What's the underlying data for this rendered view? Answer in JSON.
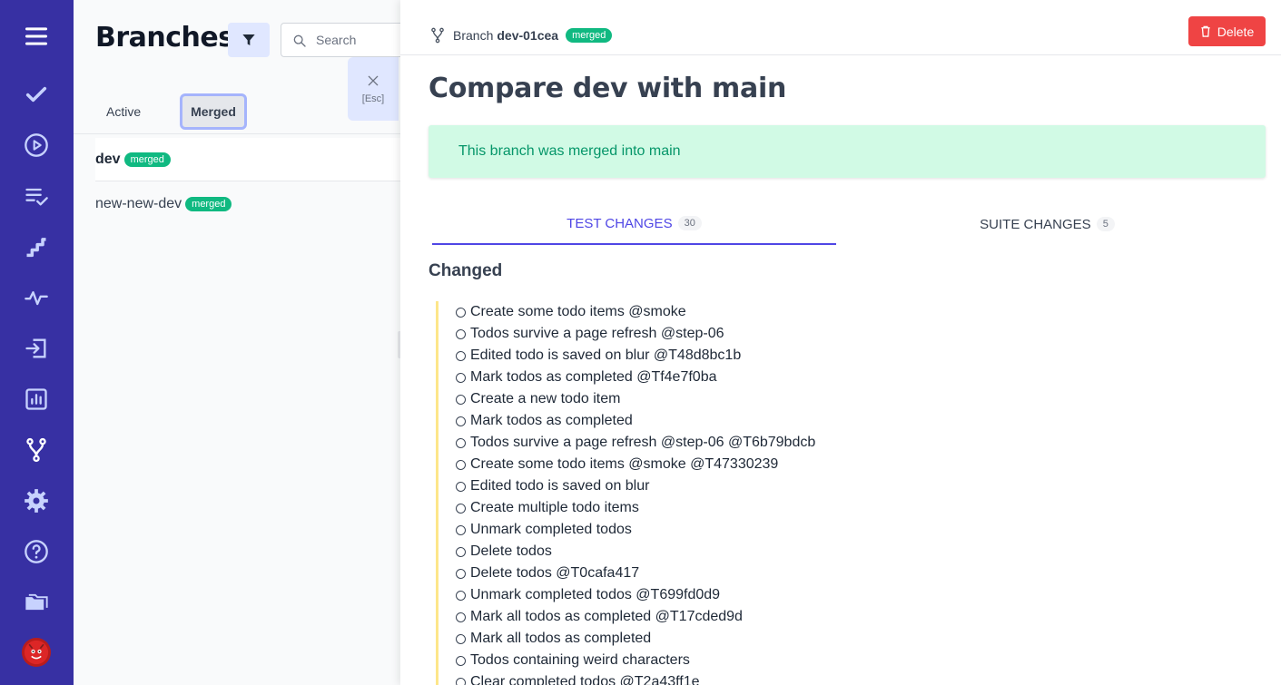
{
  "nav": {
    "items": [
      "check-icon",
      "play-circle-icon",
      "list-check-icon",
      "steps-icon",
      "pulse-icon",
      "import-icon",
      "chart-icon",
      "branch-icon",
      "gear-icon",
      "help-icon",
      "folders-icon"
    ]
  },
  "list": {
    "title": "Branches",
    "search_placeholder": "Search",
    "tab_active": "Active",
    "tab_merged": "Merged",
    "branches": [
      {
        "name": "dev",
        "badge": "merged"
      },
      {
        "name": "new-new-dev",
        "badge": "merged"
      }
    ]
  },
  "close": {
    "esc_label": "[Esc]"
  },
  "detail": {
    "crumb_prefix": "Branch",
    "branch_name": "dev-01cea",
    "branch_badge": "merged",
    "delete_label": "Delete",
    "title": "Compare dev with main",
    "merged_note": "This branch was merged into main",
    "tab_test": "TEST CHANGES",
    "tab_test_count": "30",
    "tab_suite": "SUITE CHANGES",
    "tab_suite_count": "5",
    "changed_heading": "Changed",
    "changes": [
      "Create some todo items @smoke",
      "Todos survive a page refresh @step-06",
      "Edited todo is saved on blur @T48d8bc1b",
      "Mark todos as completed @Tf4e7f0ba",
      "Create a new todo item",
      "Mark todos as completed",
      "Todos survive a page refresh @step-06 @T6b79bdcb",
      "Create some todo items @smoke @T47330239",
      "Edited todo is saved on blur",
      "Create multiple todo items",
      "Unmark completed todos",
      "Delete todos",
      "Delete todos @T0cafa417",
      "Unmark completed todos @T699fd0d9",
      "Mark all todos as completed @T17cded9d",
      "Mark all todos as completed",
      "Todos containing weird characters",
      "Clear completed todos @T2a43ff1e"
    ]
  },
  "colors": {
    "rail": "#3730a3",
    "accent": "#4f46e5",
    "success": "#10b981",
    "danger": "#ef4444"
  }
}
